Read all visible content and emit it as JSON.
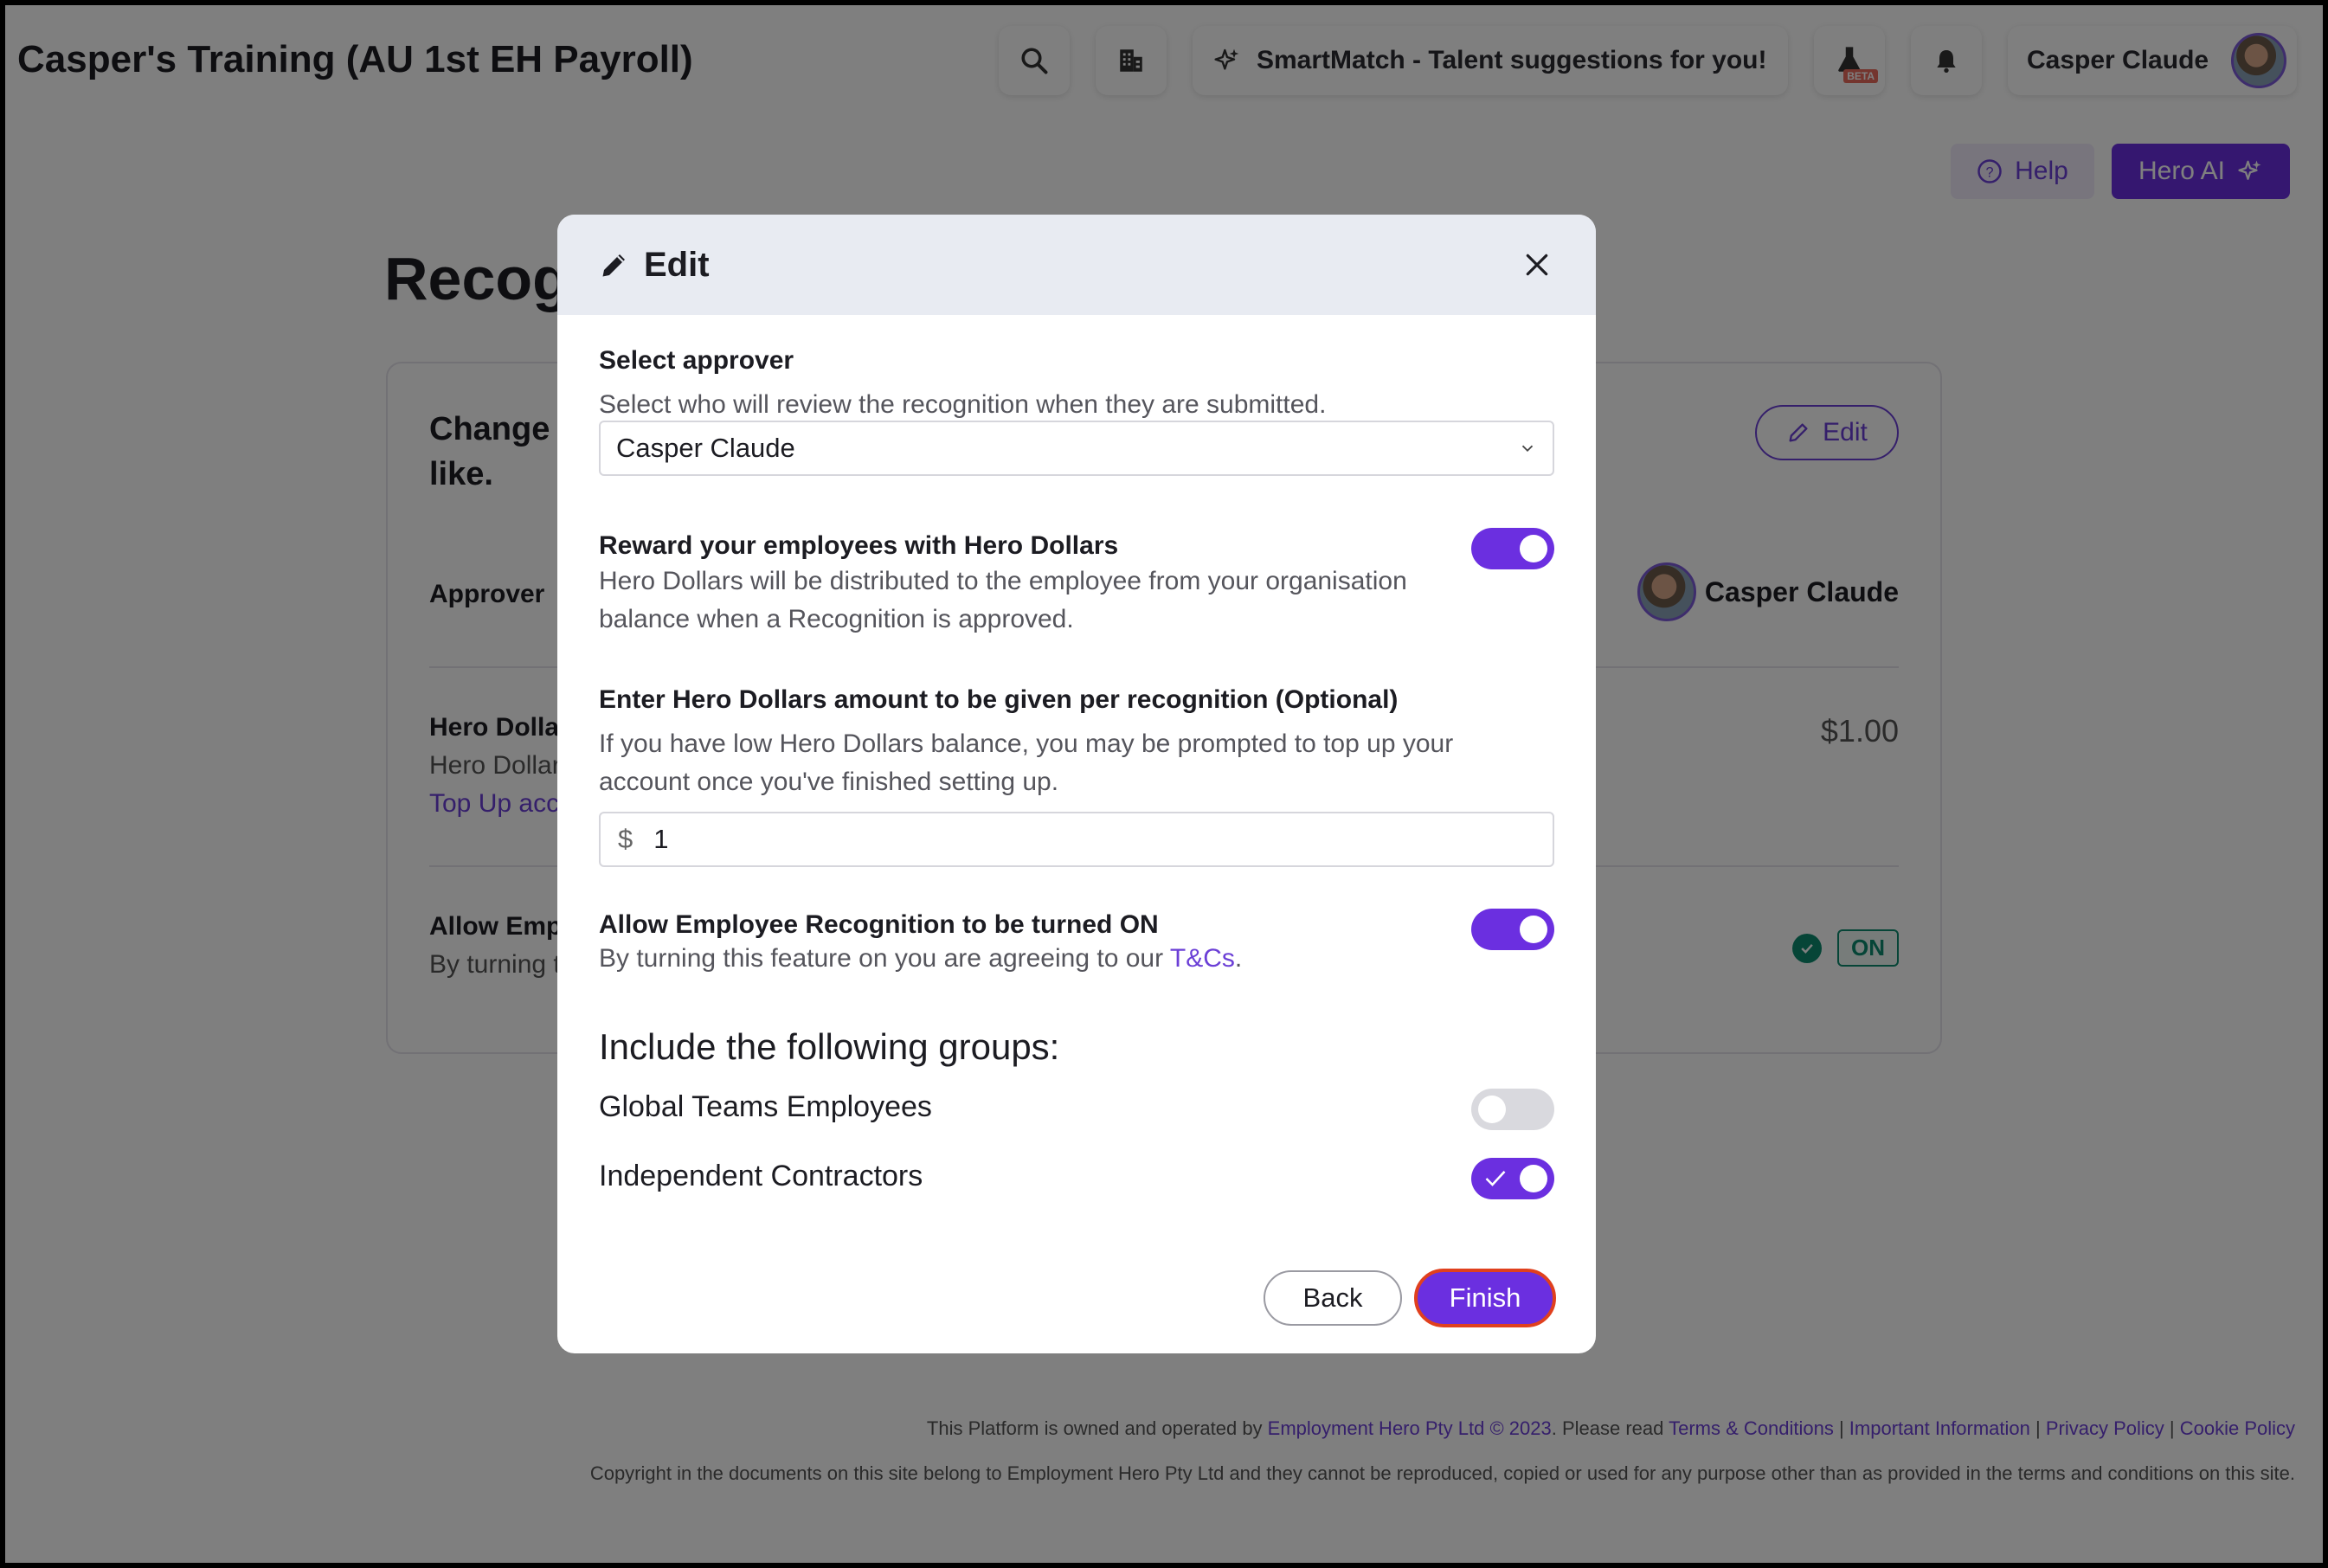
{
  "header": {
    "app_title": "Casper's Training (AU 1st EH Payroll)",
    "smartmatch_label": "SmartMatch - Talent suggestions for you!",
    "beta_label": "BETA",
    "user_name": "Casper Claude"
  },
  "actions": {
    "help_label": "Help",
    "hero_ai_label": "Hero AI"
  },
  "page": {
    "heading_visible": "Recog",
    "card_heading_visible": "Change like.",
    "card_heading_line1": "Change",
    "card_heading_line2": "like.",
    "edit_label": "Edit",
    "approver_label": "Approver",
    "approver_name": "Casper Claude",
    "hero_dollars_label": "Hero Dolla",
    "hero_dollars_sub": "Hero Dollar",
    "top_up_link": "Top Up acc",
    "hero_dollars_amount": "$1.00",
    "allow_label": "Allow Emp",
    "allow_sub": "By turning t",
    "on_badge": "ON"
  },
  "modal": {
    "title": "Edit",
    "approver": {
      "title": "Select approver",
      "desc": "Select who will review the recognition when they are submitted.",
      "selected": "Casper Claude"
    },
    "reward": {
      "title": "Reward your employees with Hero Dollars",
      "desc_line1": "Hero Dollars will be distributed to the employee from your organisation",
      "desc_line2": "balance when a Recognition is approved.",
      "enabled": true
    },
    "amount": {
      "title": "Enter Hero Dollars amount to be given per recognition (Optional)",
      "desc_line1": "If you have low Hero Dollars balance, you may be prompted to top up your",
      "desc_line2": "account once you've finished setting up.",
      "currency": "$",
      "value": "1"
    },
    "allow": {
      "title": "Allow Employee Recognition to be turned ON",
      "desc_prefix": "By turning this feature on you are agreeing to our ",
      "tc_link": "T&Cs",
      "desc_suffix": ".",
      "enabled": true
    },
    "groups": {
      "heading": "Include the following groups:",
      "items": [
        {
          "label": "Global Teams Employees",
          "enabled": false
        },
        {
          "label": "Independent Contractors",
          "enabled": true
        }
      ]
    },
    "back_label": "Back",
    "finish_label": "Finish"
  },
  "footer": {
    "line1_prefix": "This Platform is owned and operated by ",
    "company_link": "Employment Hero Pty Ltd © 2023",
    "line1_mid": ". Please read ",
    "terms_link": "Terms & Conditions",
    "sep": " | ",
    "important_link": "Important Information",
    "privacy_link": "Privacy Policy",
    "cookie_link": "Cookie Policy",
    "line2": "Copyright in the documents on this site belong to Employment Hero Pty Ltd and they cannot be reproduced, copied or used for any purpose other than as provided in the terms and conditions on this site."
  },
  "colors": {
    "brand": "#6b2fe0",
    "success": "#0c8a6e",
    "focus_ring": "#e0401e"
  }
}
